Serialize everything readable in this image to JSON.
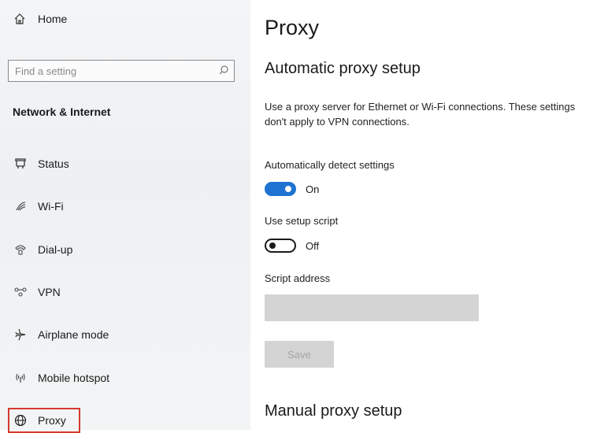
{
  "sidebar": {
    "home_label": "Home",
    "search_placeholder": "Find a setting",
    "group_title": "Network & Internet",
    "items": [
      {
        "label": "Status",
        "icon": "status-icon"
      },
      {
        "label": "Wi-Fi",
        "icon": "wifi-icon"
      },
      {
        "label": "Dial-up",
        "icon": "dialup-icon"
      },
      {
        "label": "VPN",
        "icon": "vpn-icon"
      },
      {
        "label": "Airplane mode",
        "icon": "airplane-icon"
      },
      {
        "label": "Mobile hotspot",
        "icon": "hotspot-icon"
      },
      {
        "label": "Proxy",
        "icon": "globe-icon",
        "selected": true
      }
    ]
  },
  "main": {
    "title": "Proxy",
    "auto_section_title": "Automatic proxy setup",
    "description": "Use a proxy server for Ethernet or Wi-Fi connections. These settings don't apply to VPN connections.",
    "auto_detect_label": "Automatically detect settings",
    "auto_detect_state": "On",
    "setup_script_label": "Use setup script",
    "setup_script_state": "Off",
    "script_address_label": "Script address",
    "script_address_value": "",
    "save_label": "Save",
    "manual_section_title": "Manual proxy setup"
  },
  "colors": {
    "accent": "#1e73d2",
    "highlight_border": "#d33a2c",
    "disabled_fill": "#d4d4d4"
  }
}
